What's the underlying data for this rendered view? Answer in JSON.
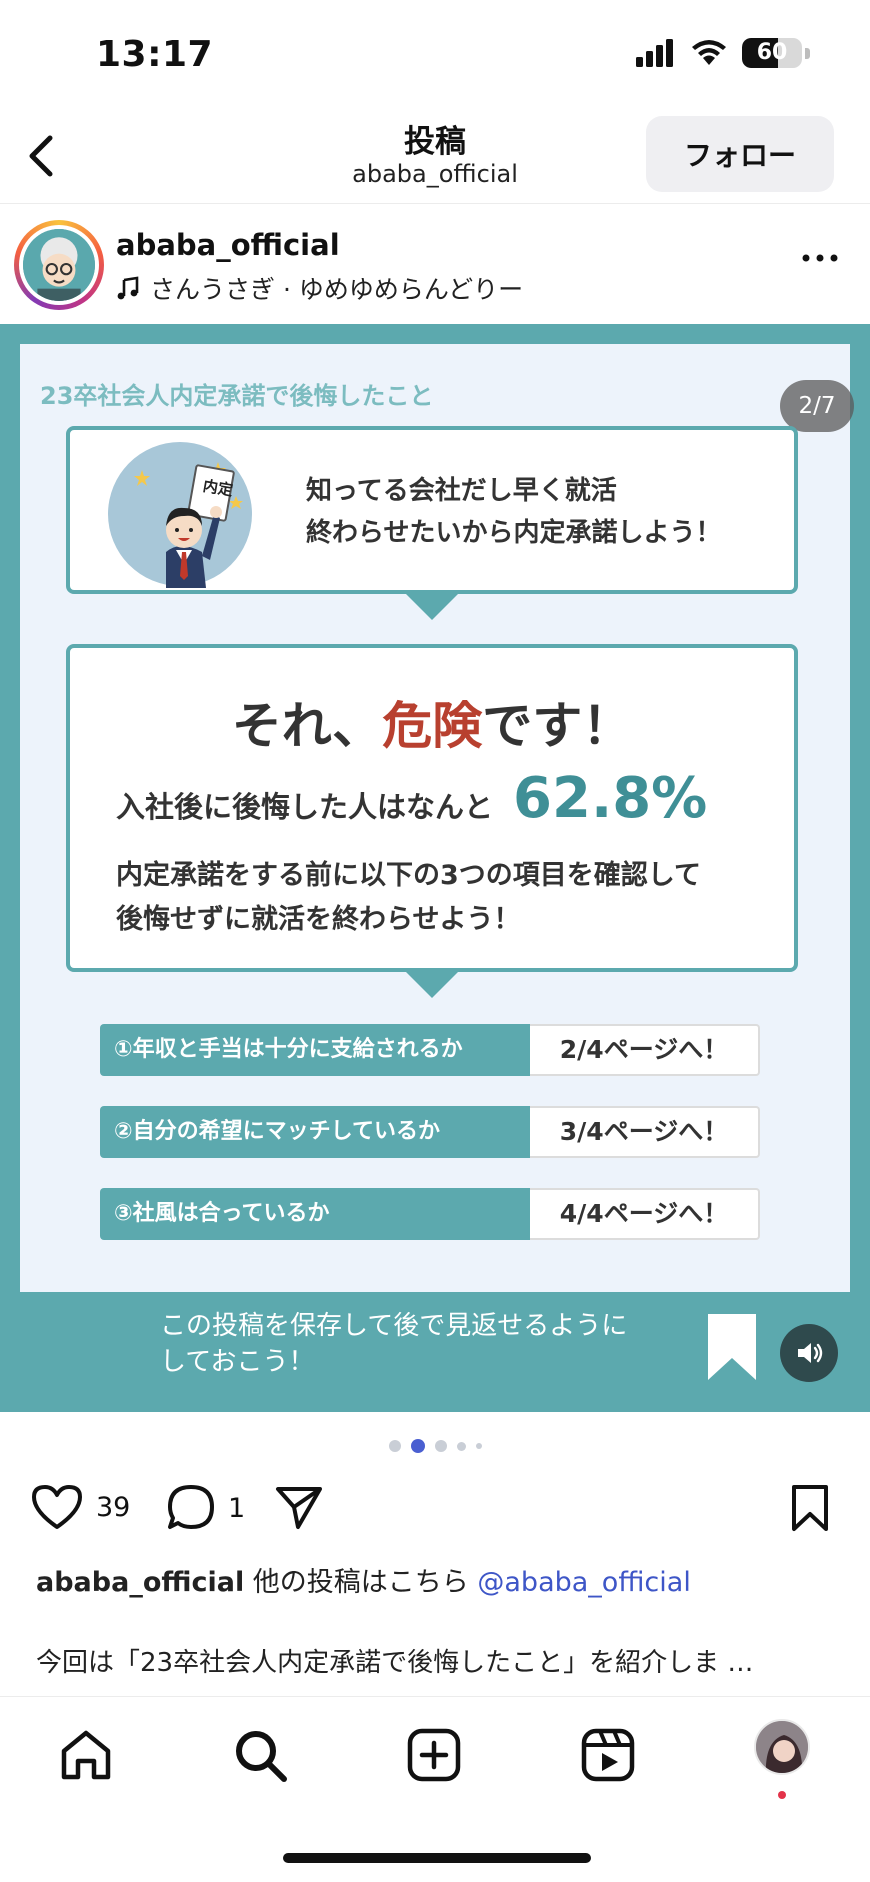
{
  "status_bar": {
    "time": "13:17",
    "battery_percent": 60,
    "battery_label": "60"
  },
  "nav": {
    "title": "投稿",
    "subtitle": "ababa_official",
    "follow_label": "フォロー"
  },
  "post": {
    "username": "ababa_official",
    "music": "さんうさぎ · ゆめゆめらんどりー"
  },
  "slide": {
    "heading": "23卒社会人内定承諾で後悔したこと",
    "page_indicator": "2/7",
    "illustration_badge": "内定",
    "box1_line1": "知ってる会社だし早く就活",
    "box1_line2": "終わらせたいから内定承諾しよう！",
    "danger_prefix": "それ、",
    "danger_highlight": "危険",
    "danger_suffix": "です！",
    "regret_text": "入社後に後悔した人はなんと",
    "regret_percent": "62.8%",
    "note_line1": "内定承諾をする前に以下の3つの項目を確認して",
    "note_line2": "後悔せずに就活を終わらせよう！",
    "checklist": [
      {
        "label": "①年収と手当は十分に支給されるか",
        "page": "2/4ページへ！"
      },
      {
        "label": "②自分の希望にマッチしているか",
        "page": "3/4ページへ！"
      },
      {
        "label": "③社風は合っているか",
        "page": "4/4ページへ！"
      }
    ],
    "save_line1": "この投稿を保存して後で見返せるように",
    "save_line2": "しておこう！"
  },
  "carousel": {
    "total_dots": 5,
    "active_index": 1
  },
  "actions": {
    "likes": "39",
    "comments": "1"
  },
  "caption": {
    "username": "ababa_official",
    "text": " 他の投稿はこちら ",
    "mention": "@ababa_official",
    "line2": "今回は「23卒社会人内定承諾で後悔したこと」を紹介しま …"
  },
  "colors": {
    "teal": "#5ca9ae",
    "danger_red": "#b8402f",
    "mention_blue": "#3e56c7"
  },
  "icons": [
    "back-arrow-icon",
    "signal-icon",
    "wifi-icon",
    "battery-icon",
    "music-note-icon",
    "more-icon",
    "bookmark-icon",
    "volume-icon",
    "heart-icon",
    "comment-icon",
    "share-icon",
    "save-icon",
    "home-icon",
    "search-icon",
    "create-icon",
    "reels-icon"
  ]
}
